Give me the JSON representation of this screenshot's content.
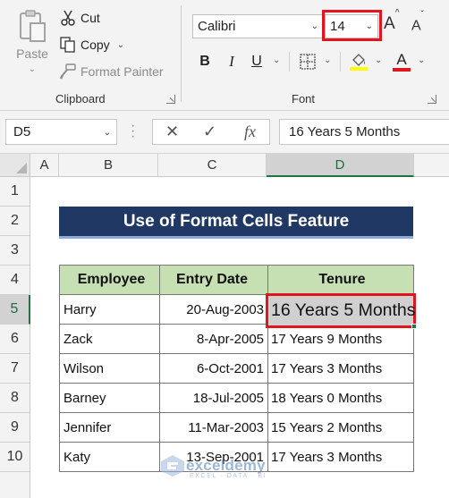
{
  "ribbon": {
    "clipboard": {
      "group_label": "Clipboard",
      "paste_label": "Paste",
      "cut_label": "Cut",
      "copy_label": "Copy",
      "format_painter_label": "Format Painter"
    },
    "font": {
      "group_label": "Font",
      "font_name": "Calibri",
      "font_size": "14",
      "bold": "B",
      "italic": "I",
      "underline": "U",
      "font_color_letter": "A",
      "font_color": "#e0161e",
      "highlight_color": "#ffff00"
    }
  },
  "formula_bar": {
    "name_box": "D5",
    "fx_label": "fx",
    "formula": "16 Years 5 Months"
  },
  "grid": {
    "columns": [
      "A",
      "B",
      "C",
      "D"
    ],
    "rows": [
      "1",
      "2",
      "3",
      "4",
      "5",
      "6",
      "7",
      "8",
      "9",
      "10"
    ],
    "active_column": "D",
    "active_row": "5"
  },
  "sheet": {
    "title": "Use of Format Cells Feature",
    "headers": [
      "Employee",
      "Entry Date",
      "Tenure"
    ],
    "records": [
      [
        "Harry",
        "20-Aug-2003",
        "16 Years 5 Months"
      ],
      [
        "Zack",
        "8-Apr-2005",
        "17 Years 9 Months"
      ],
      [
        "Wilson",
        "6-Oct-2001",
        "17 Years 3 Months"
      ],
      [
        "Barney",
        "18-Jul-2005",
        "18 Years 0 Months"
      ],
      [
        "Jennifer",
        "11-Mar-2003",
        "15 Years 2 Months"
      ],
      [
        "Katy",
        "13-Sep-2001",
        "17 Years 3 Months"
      ]
    ],
    "selected_cell_value": "16 Years 5 Months"
  },
  "watermark": {
    "name": "exceldemy",
    "tagline": "EXCEL · DATA · BI"
  },
  "colors": {
    "title_bg": "#1f3864",
    "header_bg": "#c6e0b4",
    "highlight_border": "#e0161e",
    "excel_green": "#217346"
  }
}
